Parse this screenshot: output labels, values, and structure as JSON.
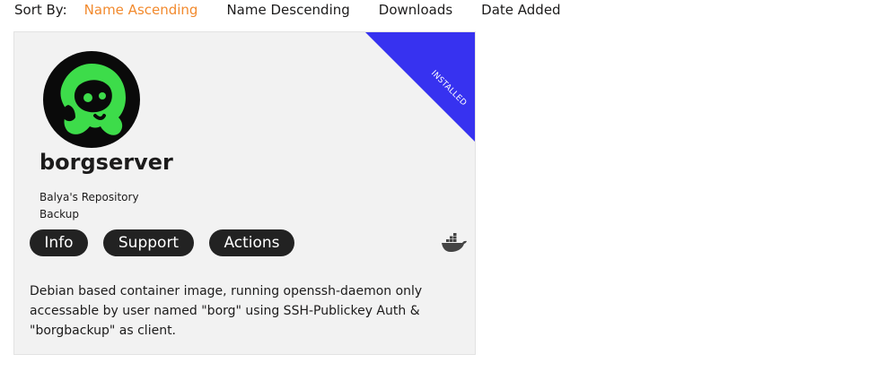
{
  "sort": {
    "label": "Sort By:",
    "options": [
      "Name Ascending",
      "Name Descending",
      "Downloads",
      "Date Added"
    ],
    "active_index": 0,
    "active_color": "#f28a2e"
  },
  "app": {
    "ribbon": "INSTALLED",
    "ribbon_color": "#3732f0",
    "name": "borgserver",
    "author": "Balya's Repository",
    "category": "Backup",
    "buttons": {
      "info": "Info",
      "support": "Support",
      "actions": "Actions"
    },
    "platform_icon": "docker-icon",
    "description": "Debian based container image, running openssh-daemon only accessable by user named \"borg\" using SSH-Publickey Auth & \"borgbackup\" as client."
  }
}
